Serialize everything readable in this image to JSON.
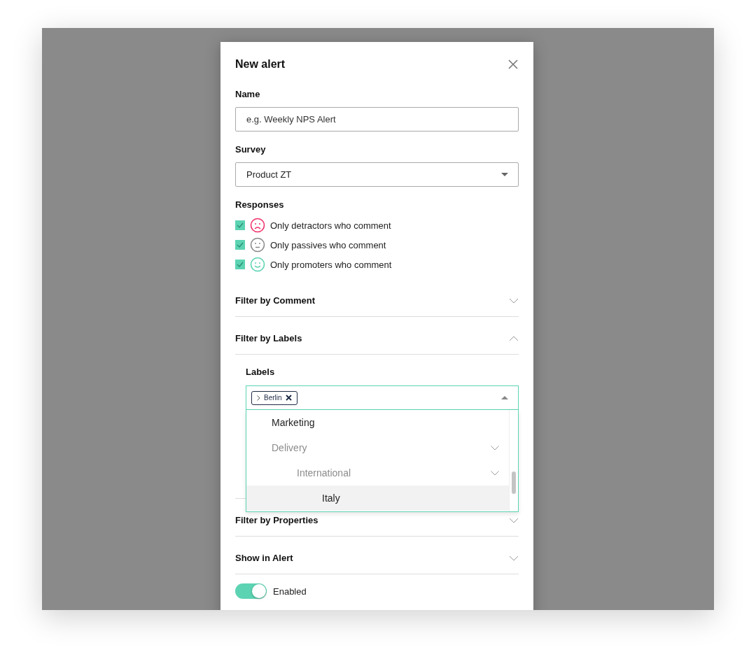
{
  "dialog": {
    "title": "New alert"
  },
  "name_field": {
    "label": "Name",
    "placeholder": "e.g. Weekly NPS Alert"
  },
  "survey_field": {
    "label": "Survey",
    "value": "Product ZT"
  },
  "responses": {
    "label": "Responses",
    "options": [
      {
        "label": "Only detractors who comment",
        "checked": true,
        "kind": "sad",
        "color": "#f0306a"
      },
      {
        "label": "Only passives who comment",
        "checked": true,
        "kind": "neutral",
        "color": "#8a8a8a"
      },
      {
        "label": "Only promoters who comment",
        "checked": true,
        "kind": "happy",
        "color": "#5cd3b2"
      }
    ]
  },
  "sections": [
    {
      "title": "Filter by Comment",
      "expanded": false
    },
    {
      "title": "Filter by Labels",
      "expanded": true,
      "labels_field": {
        "label": "Labels",
        "chips": [
          "Berlin"
        ],
        "open": true,
        "options": [
          {
            "label": "Marketing",
            "disabled": false,
            "highlighted": false
          },
          {
            "label": "Delivery",
            "disabled": true,
            "highlighted": false,
            "children": [
              {
                "label": "International",
                "disabled": true,
                "highlighted": false,
                "children": [
                  {
                    "label": "Italy",
                    "disabled": false,
                    "highlighted": true
                  }
                ]
              }
            ]
          }
        ]
      }
    },
    {
      "title": "Filter by Properties",
      "expanded": false
    },
    {
      "title": "Show in Alert",
      "expanded": false
    }
  ],
  "toggle": {
    "label": "Enabled",
    "on": true
  }
}
